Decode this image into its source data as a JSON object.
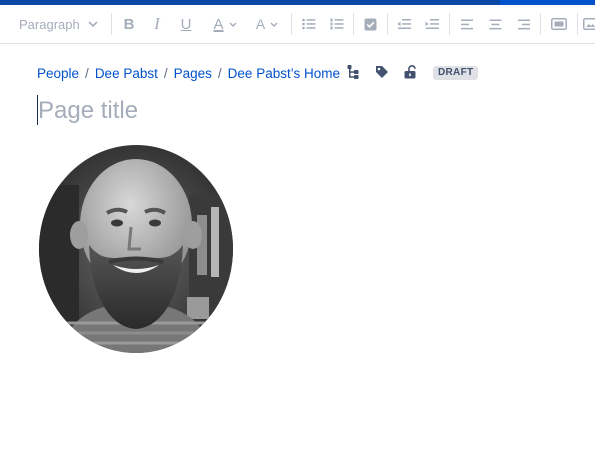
{
  "toolbar": {
    "paragraph_style": "Paragraph",
    "bold_label": "B",
    "italic_label": "I",
    "underline_label": "U",
    "text_color_label": "A",
    "text_effect_label": "A"
  },
  "breadcrumb": {
    "items": [
      "People",
      "Dee Pabst",
      "Pages",
      "Dee Pabst’s Home"
    ],
    "separator": "/"
  },
  "page": {
    "status": "DRAFT",
    "title_placeholder": "Page title"
  },
  "icons": [
    "chevron-down-icon",
    "bullet-list-icon",
    "numbered-list-icon",
    "task-checkbox-icon",
    "outdent-icon",
    "indent-icon",
    "align-left-icon",
    "align-center-icon",
    "align-right-icon",
    "layout-icon",
    "page-tree-icon",
    "label-tag-icon",
    "unlock-icon"
  ],
  "colors": {
    "link": "#0052cc",
    "top_bar": "#0747a6",
    "toolbar_icon": "#a5adba",
    "status_badge_bg": "#dfe1e6"
  }
}
